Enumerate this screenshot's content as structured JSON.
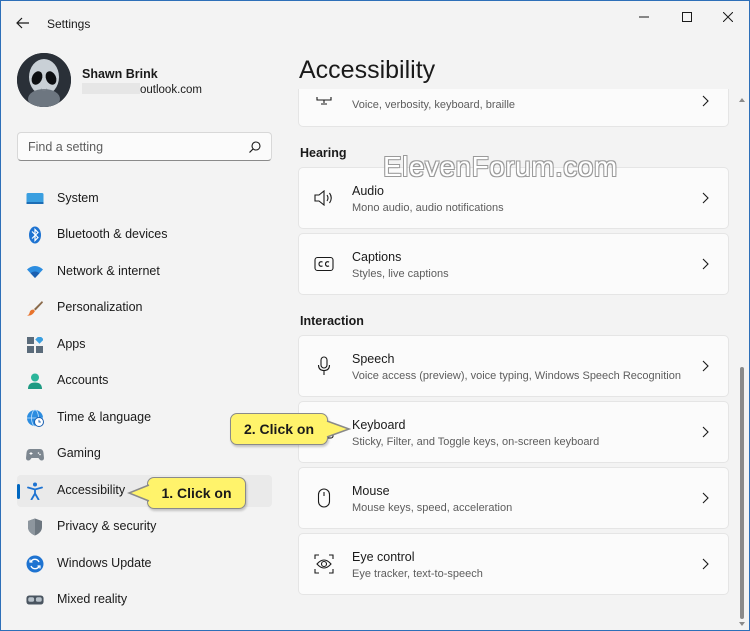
{
  "titlebar": {
    "title": "Settings"
  },
  "profile": {
    "name": "Shawn Brink",
    "email": "outlook.com"
  },
  "search": {
    "placeholder": "Find a setting"
  },
  "nav": {
    "items": [
      {
        "label": "System",
        "icon": "system-icon"
      },
      {
        "label": "Bluetooth & devices",
        "icon": "bluetooth-icon"
      },
      {
        "label": "Network & internet",
        "icon": "wifi-icon"
      },
      {
        "label": "Personalization",
        "icon": "brush-icon"
      },
      {
        "label": "Apps",
        "icon": "apps-icon"
      },
      {
        "label": "Accounts",
        "icon": "person-icon"
      },
      {
        "label": "Time & language",
        "icon": "globe-clock-icon"
      },
      {
        "label": "Gaming",
        "icon": "gamepad-icon"
      },
      {
        "label": "Accessibility",
        "icon": "accessibility-icon",
        "selected": true
      },
      {
        "label": "Privacy & security",
        "icon": "shield-icon"
      },
      {
        "label": "Windows Update",
        "icon": "update-icon"
      },
      {
        "label": "Mixed reality",
        "icon": "headset-icon"
      }
    ]
  },
  "main": {
    "title": "Accessibility",
    "partial_card": {
      "desc": "Voice, verbosity, keyboard, braille"
    },
    "sections": [
      {
        "title": "Hearing",
        "cards": [
          {
            "title": "Audio",
            "desc": "Mono audio, audio notifications",
            "icon": "speaker-icon"
          },
          {
            "title": "Captions",
            "desc": "Styles, live captions",
            "icon": "captions-icon"
          }
        ]
      },
      {
        "title": "Interaction",
        "cards": [
          {
            "title": "Speech",
            "desc": "Voice access (preview), voice typing, Windows Speech Recognition",
            "icon": "microphone-icon"
          },
          {
            "title": "Keyboard",
            "desc": "Sticky, Filter, and Toggle keys, on-screen keyboard",
            "icon": "keyboard-icon"
          },
          {
            "title": "Mouse",
            "desc": "Mouse keys, speed, acceleration",
            "icon": "mouse-icon"
          },
          {
            "title": "Eye control",
            "desc": "Eye tracker, text-to-speech",
            "icon": "eye-camera-icon"
          }
        ]
      }
    ]
  },
  "watermark": "ElevenForum.com",
  "callouts": {
    "step1": "1. Click on",
    "step2": "2. Click on"
  },
  "colors": {
    "accent": "#0067c0",
    "callout": "#fff36b",
    "background": "#f3f3f3",
    "card": "#fbfbfb"
  }
}
